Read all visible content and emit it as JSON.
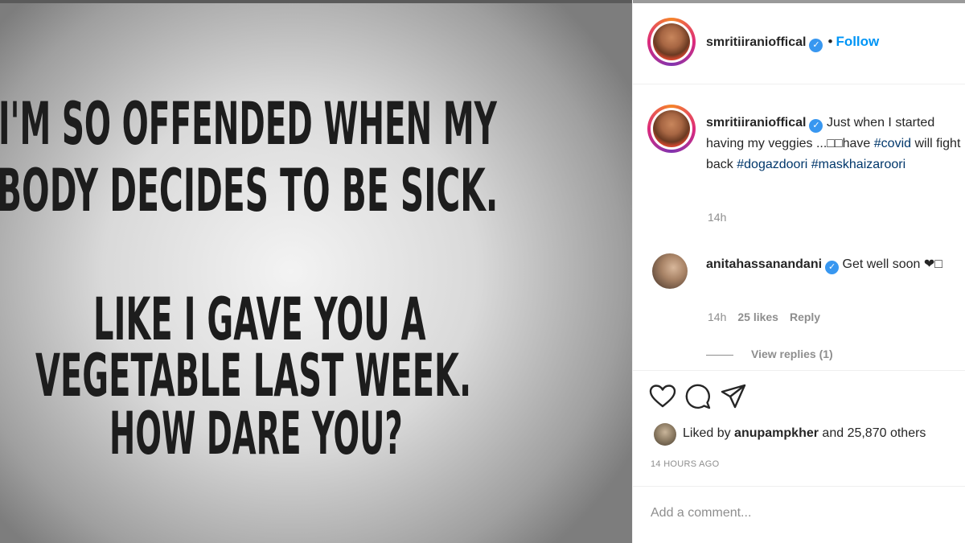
{
  "post_image": {
    "lines": [
      "I'M SO OFFENDED WHEN MY",
      "BODY DECIDES TO BE SICK.",
      "LIKE I GAVE YOU A",
      "VEGETABLE LAST WEEK.",
      "HOW DARE YOU?"
    ]
  },
  "header": {
    "username": "smritiiranioffical",
    "separator": "•",
    "follow_label": "Follow"
  },
  "caption": {
    "username": "smritiiranioffical",
    "text": "Just when I started having my veggies ...□□have",
    "hashtag_1": "#covid",
    "text_2": "will fight back",
    "hashtag_2": "#dogazdoori",
    "hashtag_3": "#maskhaizaroori",
    "time": "14h"
  },
  "comment": {
    "username": "anitahassanandani",
    "text": "Get well soon ❤□",
    "time": "14h",
    "likes": "25 likes",
    "reply_label": "Reply",
    "view_replies": "View replies (1)"
  },
  "likes": {
    "prefix": "Liked by",
    "user": "anupampkher",
    "suffix": "and 25,870 others"
  },
  "post_time": "14 HOURS AGO",
  "comment_input": {
    "placeholder": "Add a comment..."
  },
  "icons": [
    "heart-icon",
    "comment-icon",
    "share-icon",
    "verified-badge-icon"
  ],
  "colors": {
    "link": "#0095f6",
    "hashtag": "#00376b",
    "muted": "#8e8e8e",
    "verified": "#3897f0"
  }
}
